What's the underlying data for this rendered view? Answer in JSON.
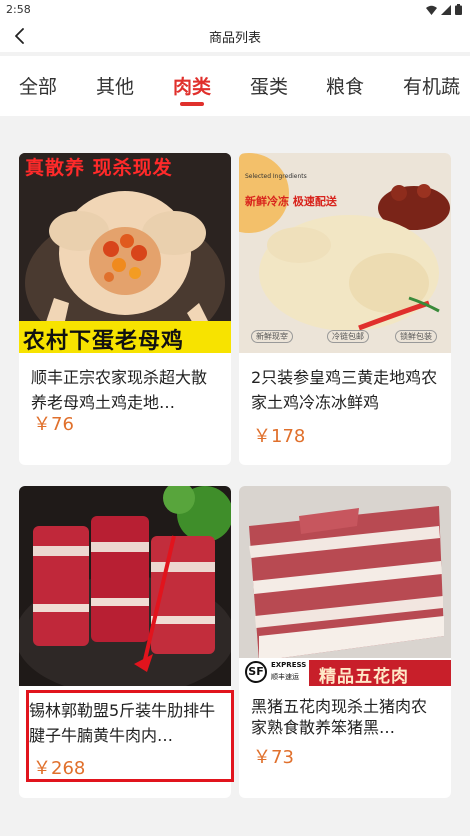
{
  "status": {
    "time": "2:58"
  },
  "header": {
    "title": "商品列表"
  },
  "tabs": [
    {
      "label": "全部"
    },
    {
      "label": "其他"
    },
    {
      "label": "肉类"
    },
    {
      "label": "蛋类"
    },
    {
      "label": "粮食"
    },
    {
      "label": "有机蔬"
    }
  ],
  "products": [
    {
      "title": "顺丰正宗农家现杀超大散养老母鸡土鸡走地…",
      "price": "￥76",
      "image_text": {
        "top": "真散养  现杀现发",
        "bottom": "农村下蛋老母鸡"
      }
    },
    {
      "title": "2只装参皇鸡三黄走地鸡农家土鸡冷冻冰鲜鸡",
      "price": "￥178",
      "image_text": {
        "top_small": "Selected Ingredients",
        "top": "新鲜冷冻  极速配送",
        "badges": [
          "新鲜现宰",
          "冷链包邮",
          "锁鲜包装"
        ]
      }
    },
    {
      "title": "锡林郭勒盟5斤装牛肋排牛腱子牛腩黄牛肉内…",
      "price": "￥268"
    },
    {
      "title": "黑猪五花肉现杀土猪肉农家熟食散养笨猪黑…",
      "price": "￥73",
      "image_text": {
        "logo": "SF",
        "logo_sub1": "EXPRESS",
        "logo_sub2": "顺丰速运",
        "banner": "精品五花肉"
      }
    }
  ],
  "colors": {
    "accent": "#e0302c",
    "price": "#e0702c",
    "highlight": "#e1141d"
  }
}
